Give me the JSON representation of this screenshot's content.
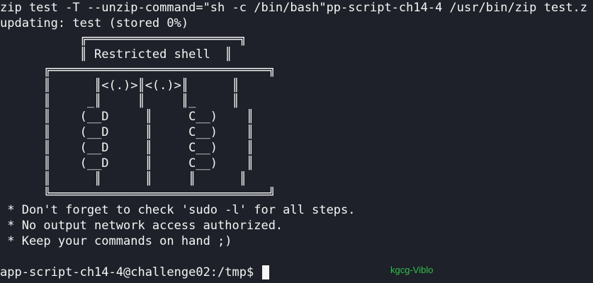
{
  "terminal": {
    "command_line": "zip test -T --unzip-command=\"sh -c /bin/bash\"pp-script-ch14-4 /usr/bin/zip test.z",
    "output_line": "updating: test (stored 0%)",
    "banner": [
      "           ╔═════════════════════╗",
      "           ║ Restricted shell  ║",
      "      ╔══════════════════════════════╗",
      "      ║      ║<(.)>║<(.)>║      ║",
      "      ║     _║     ║     ║_     ║",
      "      ║    (__D     ║     C__)    ║",
      "      ║    (__D     ║     C__)    ║",
      "      ║    (__D     ║     C__)    ║",
      "      ║    (__D     ║     C__)    ║",
      "      ║      ║      ║     ║      ║",
      "      ╚══════════════════════════════╝"
    ],
    "notes": [
      " * Don't forget to check 'sudo -l' for all steps.",
      " * No output network access authorized.",
      " * Keep your commands on hand ;)"
    ],
    "prompt": "app-script-ch14-4@challenge02:/tmp$ "
  },
  "watermark": "kgcg-Viblo",
  "colors": {
    "background": "#1e2129",
    "foreground": "#f5f5f5",
    "watermark": "#2fbf4a"
  }
}
